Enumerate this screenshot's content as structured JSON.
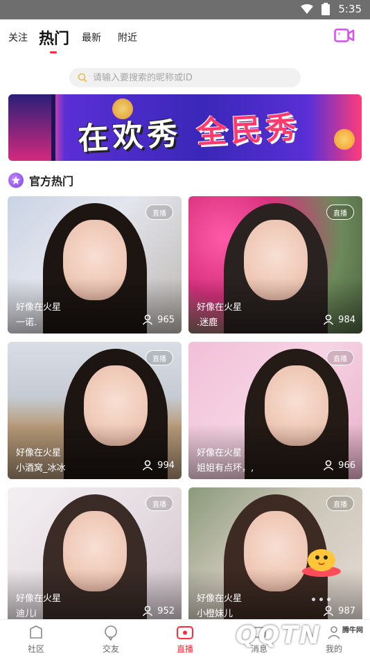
{
  "status_bar": {
    "time": "5:35"
  },
  "top_nav": {
    "tabs": [
      {
        "label": "关注"
      },
      {
        "label": "热门"
      },
      {
        "label": "最新"
      },
      {
        "label": "附近"
      }
    ],
    "active_tab": "热门"
  },
  "search": {
    "placeholder": "请输入要搜索的昵称或ID"
  },
  "banner": {
    "text_left": "在欢秀",
    "text_right": "全民秀"
  },
  "section": {
    "title": "官方热门"
  },
  "cards": [
    {
      "tag": "直播",
      "caption": "好像在火星",
      "name": "一诺.",
      "viewers": "965"
    },
    {
      "tag": "直播",
      "caption": "好像在火星",
      "name": ".迷鹿",
      "viewers": "984"
    },
    {
      "tag": "直播",
      "caption": "好像在火星",
      "name": "小酒窝_冰冰",
      "viewers": "994"
    },
    {
      "tag": "直播",
      "caption": "好像在火星",
      "name": "姐姐有点坏，,",
      "viewers": "966"
    },
    {
      "tag": "直播",
      "caption": "好像在火星",
      "name": "迪儿i",
      "viewers": "952"
    },
    {
      "tag": "直播",
      "caption": "好像在火星",
      "name": "小橙妹儿",
      "viewers": "987"
    }
  ],
  "bottom_nav": {
    "items": [
      {
        "label": "社区"
      },
      {
        "label": "交友"
      },
      {
        "label": "直播"
      },
      {
        "label": "消息"
      },
      {
        "label": "我的"
      }
    ],
    "active": "直播"
  },
  "watermark": {
    "text": "QQTN",
    "small": "腾牛网"
  },
  "colors": {
    "accent": "#ff2d3b",
    "video_icon": "#d94cf0"
  }
}
